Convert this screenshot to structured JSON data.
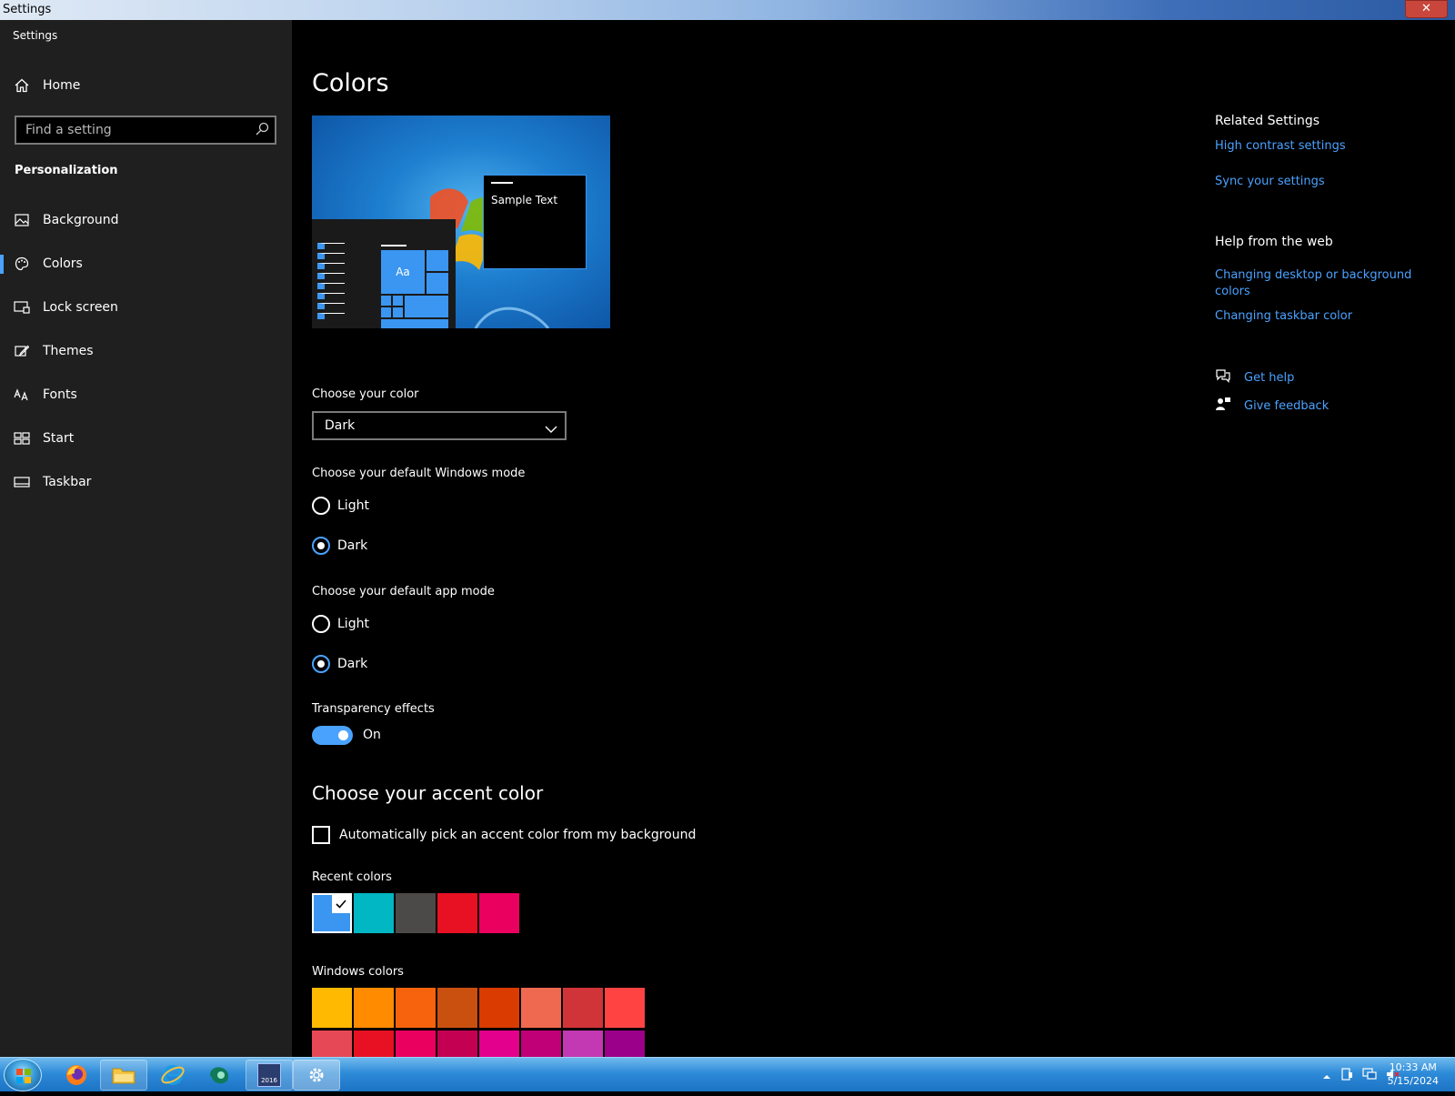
{
  "window": {
    "title": "Settings",
    "close_glyph": "✕"
  },
  "sidebar": {
    "app_title": "Settings",
    "home_label": "Home",
    "search_placeholder": "Find a setting",
    "section": "Personalization",
    "items": [
      {
        "label": "Background",
        "icon": "picture-icon"
      },
      {
        "label": "Colors",
        "icon": "palette-icon",
        "active": true
      },
      {
        "label": "Lock screen",
        "icon": "lock-screen-icon"
      },
      {
        "label": "Themes",
        "icon": "brush-icon"
      },
      {
        "label": "Fonts",
        "icon": "fonts-icon"
      },
      {
        "label": "Start",
        "icon": "start-grid-icon"
      },
      {
        "label": "Taskbar",
        "icon": "taskbar-icon"
      }
    ]
  },
  "main": {
    "title": "Colors",
    "preview": {
      "sample_text": "Sample Text",
      "tile_text": "Aa"
    },
    "choose_color": {
      "label": "Choose your color",
      "value": "Dark"
    },
    "windows_mode": {
      "label": "Choose your default Windows mode",
      "options": [
        "Light",
        "Dark"
      ],
      "selected": "Dark"
    },
    "app_mode": {
      "label": "Choose your default app mode",
      "options": [
        "Light",
        "Dark"
      ],
      "selected": "Dark"
    },
    "transparency": {
      "label": "Transparency effects",
      "state": "On"
    },
    "accent": {
      "title": "Choose your accent color",
      "auto_pick_label": "Automatically pick an accent color from my background",
      "recent_label": "Recent colors",
      "recent_colors": [
        "#3a96f0",
        "#00b7c3",
        "#4c4a48",
        "#e81123",
        "#ea005e"
      ],
      "windows_label": "Windows colors",
      "windows_colors_row1": [
        "#ffb900",
        "#ff8c00",
        "#f7630c",
        "#ca5010",
        "#da3b01",
        "#ef6950",
        "#d13438",
        "#ff4343"
      ],
      "windows_colors_row2": [
        "#e74856",
        "#e81123",
        "#ea005e",
        "#c30052",
        "#e3008c",
        "#bf0077",
        "#c239b3",
        "#9a0089"
      ]
    }
  },
  "right": {
    "related_title": "Related Settings",
    "related_links": [
      "High contrast settings",
      "Sync your settings"
    ],
    "help_title": "Help from the web",
    "help_links": [
      "Changing desktop or background colors",
      "Changing taskbar color"
    ],
    "get_help": "Get help",
    "give_feedback": "Give feedback"
  },
  "taskbar": {
    "apps": [
      "firefox-icon",
      "file-explorer-icon",
      "internet-explorer-icon",
      "app-icon",
      "app-2016-icon",
      "settings-gear-icon"
    ],
    "app_badge": "2016",
    "time": "10:33 AM",
    "date": "5/15/2024"
  }
}
